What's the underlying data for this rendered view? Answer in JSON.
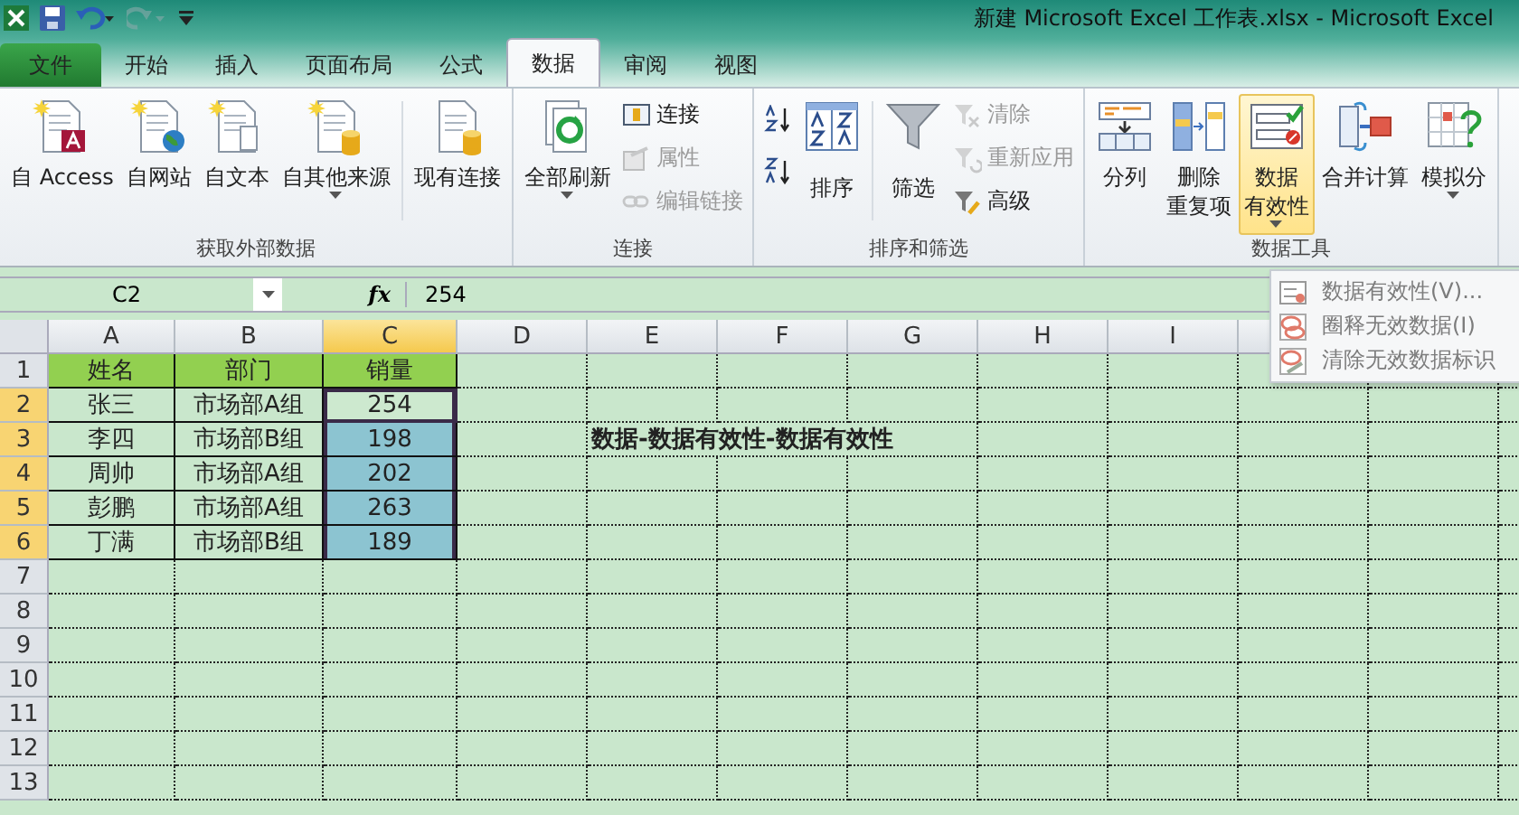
{
  "window": {
    "title": "新建 Microsoft Excel 工作表.xlsx  -  Microsoft Excel"
  },
  "quick_access": [
    {
      "kind": "app",
      "disabled": false
    },
    {
      "kind": "save",
      "disabled": false
    },
    {
      "kind": "undo",
      "disabled": false
    },
    {
      "kind": "redo",
      "disabled": true
    },
    {
      "kind": "customize",
      "disabled": false
    }
  ],
  "tabs": [
    {
      "label": "文件",
      "kind": "file",
      "selected": false
    },
    {
      "label": "开始",
      "kind": "tab",
      "selected": false
    },
    {
      "label": "插入",
      "kind": "tab",
      "selected": false
    },
    {
      "label": "页面布局",
      "kind": "tab",
      "selected": false
    },
    {
      "label": "公式",
      "kind": "tab",
      "selected": false
    },
    {
      "label": "数据",
      "kind": "tab",
      "selected": true
    },
    {
      "label": "审阅",
      "kind": "tab",
      "selected": false
    },
    {
      "label": "视图",
      "kind": "tab",
      "selected": false
    }
  ],
  "ribbon": {
    "groups": [
      {
        "label": "获取外部数据",
        "items": [
          {
            "kind": "large",
            "lines": [
              "自 Access"
            ],
            "dropdown": false,
            "pressed": false
          },
          {
            "kind": "large",
            "lines": [
              "自网站"
            ],
            "dropdown": false,
            "pressed": false
          },
          {
            "kind": "large",
            "lines": [
              "自文本"
            ],
            "dropdown": false,
            "pressed": false
          },
          {
            "kind": "large",
            "lines": [
              "自其他来源"
            ],
            "dropdown": true,
            "pressed": false
          },
          {
            "kind": "separator"
          },
          {
            "kind": "large",
            "lines": [
              "现有连接"
            ],
            "dropdown": false,
            "pressed": false
          }
        ]
      },
      {
        "label": "连接",
        "items": [
          {
            "kind": "large",
            "lines": [
              "全部刷新"
            ],
            "dropdown": true,
            "pressed": false
          },
          {
            "kind": "stack",
            "items": [
              {
                "label": "连接",
                "disabled": false
              },
              {
                "label": "属性",
                "disabled": true
              },
              {
                "label": "编辑链接",
                "disabled": true
              }
            ]
          }
        ]
      },
      {
        "label": "排序和筛选",
        "items": [
          {
            "kind": "icons",
            "items": [
              {
                "kind": "ascending"
              },
              {
                "kind": "descending"
              }
            ]
          },
          {
            "kind": "large",
            "lines": [
              "排序"
            ],
            "dropdown": false,
            "pressed": false
          },
          {
            "kind": "separator"
          },
          {
            "kind": "large",
            "lines": [
              "筛选"
            ],
            "dropdown": false,
            "pressed": false
          },
          {
            "kind": "stack",
            "items": [
              {
                "label": "清除",
                "disabled": true
              },
              {
                "label": "重新应用",
                "disabled": true
              },
              {
                "label": "高级",
                "disabled": false
              }
            ]
          }
        ]
      },
      {
        "label": "数据工具",
        "items": [
          {
            "kind": "large",
            "lines": [
              "分列"
            ],
            "dropdown": false,
            "pressed": false
          },
          {
            "kind": "large",
            "lines": [
              "删除",
              "重复项"
            ],
            "dropdown": false,
            "pressed": false
          },
          {
            "kind": "large",
            "lines": [
              "数据",
              "有效性"
            ],
            "dropdown": true,
            "pressed": true
          },
          {
            "kind": "large",
            "lines": [
              "合并计算"
            ],
            "dropdown": false,
            "pressed": false
          },
          {
            "kind": "large",
            "lines": [
              "模拟分"
            ],
            "dropdown": true,
            "pressed": false
          }
        ]
      }
    ]
  },
  "formula_bar": {
    "name_box": "C2",
    "function_label": "fx",
    "value": "254"
  },
  "sheet": {
    "columns": [
      {
        "label": "A",
        "selected": false
      },
      {
        "label": "B",
        "selected": false
      },
      {
        "label": "C",
        "selected": true
      },
      {
        "label": "D",
        "selected": false
      },
      {
        "label": "E",
        "selected": false
      },
      {
        "label": "F",
        "selected": false
      },
      {
        "label": "G",
        "selected": false
      },
      {
        "label": "H",
        "selected": false
      },
      {
        "label": "I",
        "selected": false
      }
    ],
    "rows": [
      {
        "label": "1",
        "selected": false,
        "cells": [
          {
            "text": "姓名",
            "kind": "header",
            "selected": false,
            "active": false
          },
          {
            "text": "部门",
            "kind": "header",
            "selected": false,
            "active": false
          },
          {
            "text": "销量",
            "kind": "header",
            "selected": false,
            "active": false
          }
        ]
      },
      {
        "label": "2",
        "selected": true,
        "cells": [
          {
            "text": "张三",
            "kind": "data",
            "selected": false,
            "active": false
          },
          {
            "text": "市场部A组",
            "kind": "data",
            "selected": false,
            "active": false
          },
          {
            "text": "254",
            "kind": "data",
            "selected": true,
            "active": true
          }
        ]
      },
      {
        "label": "3",
        "selected": true,
        "cells": [
          {
            "text": "李四",
            "kind": "data",
            "selected": false,
            "active": false
          },
          {
            "text": "市场部B组",
            "kind": "data",
            "selected": false,
            "active": false
          },
          {
            "text": "198",
            "kind": "data",
            "selected": true,
            "active": false
          },
          {
            "text": ""
          },
          {
            "text": "数据-数据有效性-数据有效性",
            "kind": "note"
          }
        ]
      },
      {
        "label": "4",
        "selected": true,
        "cells": [
          {
            "text": "周帅",
            "kind": "data",
            "selected": false,
            "active": false
          },
          {
            "text": "市场部A组",
            "kind": "data",
            "selected": false,
            "active": false
          },
          {
            "text": "202",
            "kind": "data",
            "selected": true,
            "active": false
          }
        ]
      },
      {
        "label": "5",
        "selected": true,
        "cells": [
          {
            "text": "彭鹏",
            "kind": "data",
            "selected": false,
            "active": false
          },
          {
            "text": "市场部A组",
            "kind": "data",
            "selected": false,
            "active": false
          },
          {
            "text": "263",
            "kind": "data",
            "selected": true,
            "active": false
          }
        ]
      },
      {
        "label": "6",
        "selected": true,
        "cells": [
          {
            "text": "丁满",
            "kind": "data",
            "selected": false,
            "active": false
          },
          {
            "text": "市场部B组",
            "kind": "data",
            "selected": false,
            "active": false
          },
          {
            "text": "189",
            "kind": "data",
            "selected": true,
            "active": false
          }
        ]
      },
      {
        "label": "7",
        "selected": false,
        "cells": []
      },
      {
        "label": "8",
        "selected": false,
        "cells": []
      },
      {
        "label": "9",
        "selected": false,
        "cells": []
      },
      {
        "label": "10",
        "selected": false,
        "cells": []
      },
      {
        "label": "11",
        "selected": false,
        "cells": []
      },
      {
        "label": "12",
        "selected": false,
        "cells": []
      },
      {
        "label": "13",
        "selected": false,
        "cells": []
      }
    ]
  },
  "menu": {
    "items": [
      {
        "label": "数据有效性(V)..."
      },
      {
        "label": "圈释无效数据(I)"
      },
      {
        "label": "清除无效数据标识"
      }
    ]
  }
}
